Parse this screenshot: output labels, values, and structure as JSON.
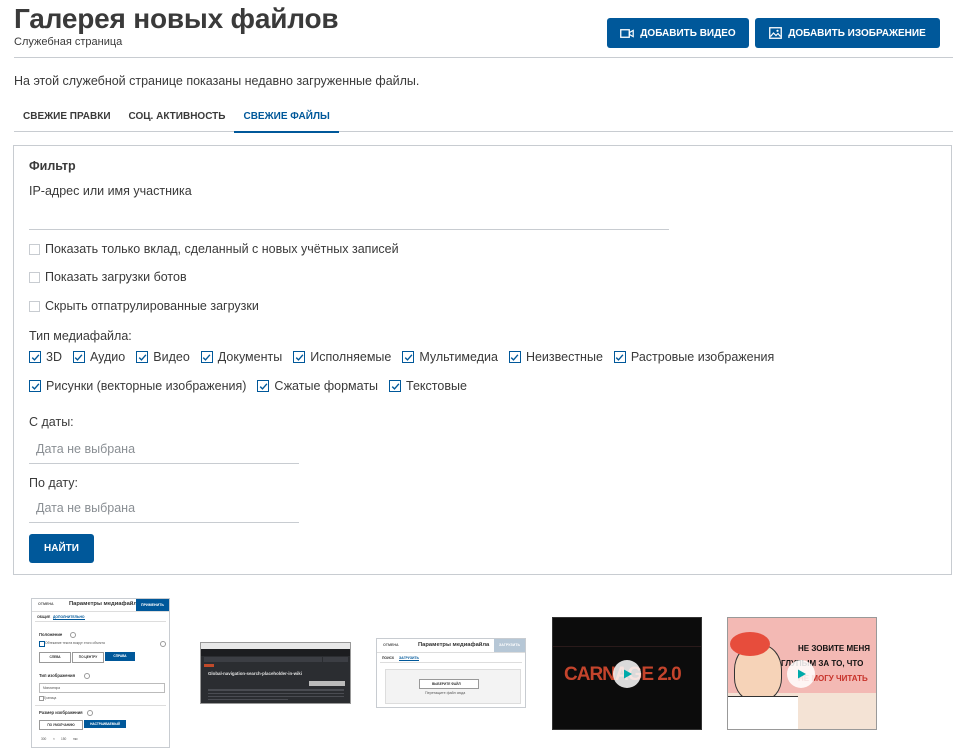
{
  "header": {
    "title": "Галерея новых файлов",
    "subtitle": "Служебная страница",
    "add_video_label": "Добавить видео",
    "add_image_label": "Добавить изображение"
  },
  "intro": "На этой служебной странице показаны недавно загруженные файлы.",
  "tabs": [
    {
      "label": "Свежие правки",
      "active": false
    },
    {
      "label": "Соц. активность",
      "active": false
    },
    {
      "label": "Свежие файлы",
      "active": true
    }
  ],
  "filter": {
    "title": "Фильтр",
    "user_label": "IP-адрес или имя участника",
    "checkboxes": [
      {
        "label": "Показать только вклад, сделанный с новых учётных записей",
        "checked": false
      },
      {
        "label": "Показать загрузки ботов",
        "checked": false
      },
      {
        "label": "Скрыть отпатрулированные загрузки",
        "checked": false
      }
    ],
    "media_type_label": "Тип медиафайла:",
    "media_types_row1": [
      "3D",
      "Аудио",
      "Видео",
      "Документы",
      "Исполняемые",
      "Мультимедиа",
      "Неизвестные",
      "Растровые изображения"
    ],
    "media_types_row2": [
      "Рисунки (векторные изображения)",
      "Сжатые форматы",
      "Текстовые"
    ],
    "from_label": "С даты:",
    "from_placeholder": "Дата не выбрана",
    "to_label": "По дату:",
    "to_placeholder": "Дата не выбрана",
    "submit_label": "Найти"
  },
  "thumbs": {
    "t1": {
      "cancel": "Отмена",
      "title": "Параметры медиафайла",
      "apply": "Применить",
      "tab_main": "Общие",
      "tab_adv": "Дополнительно",
      "position": "Положение",
      "wrap": "Обтекание текста вокруг этого объекта",
      "left": "Слева",
      "center": "По центру",
      "right": "Справа",
      "img_type": "Тип изображения",
      "img_type_value": "Миниатюра",
      "border": "Граница",
      "size": "Размер изображения",
      "default": "По умолчанию",
      "custom": "Настраиваемый",
      "w": "300",
      "h": "150",
      "px": "пкс"
    },
    "t2": {
      "heading": "Global-navigation-search-placeholder-in-wiki"
    },
    "t3": {
      "cancel": "Отмена",
      "title": "Параметры медиафайла",
      "upload": "Загрузить",
      "tab1": "Поиск",
      "tab2": "Загрузить",
      "choose": "Выберите файл",
      "drop": "Перетащите файл сюда"
    },
    "t4": {
      "text": "CARNAGE 2.0"
    },
    "t5": {
      "line1": "НЕ ЗОВИТЕ МЕНЯ",
      "line2": "ГЛУПЫМ ЗА ТО, ЧТО",
      "line3": "НЕ МОГУ ЧИТАТЬ"
    }
  },
  "colors": {
    "primary": "#00589a",
    "border": "#c8ccd1",
    "text": "#3a3a3a",
    "placeholder": "#8a8f94"
  }
}
